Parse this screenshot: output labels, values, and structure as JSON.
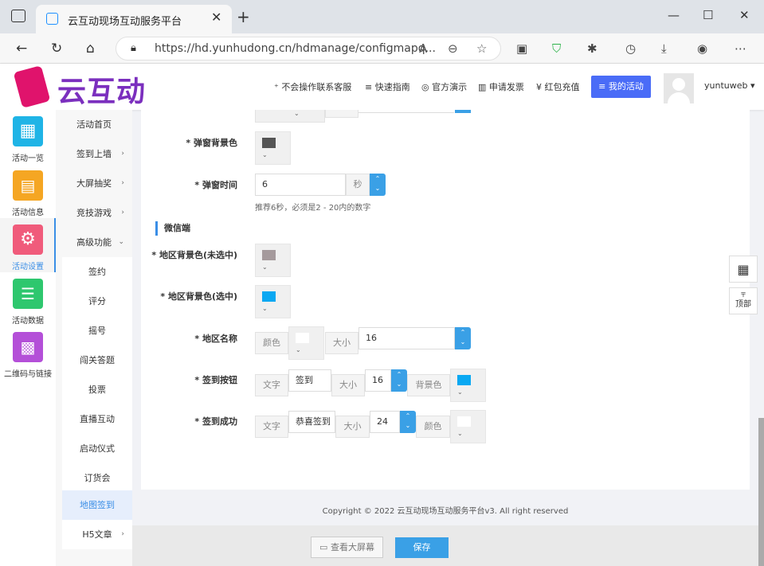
{
  "browser": {
    "tab_title": "云互动现场互动服务平台",
    "tab_close": "✕",
    "new_tab": "+",
    "url": "https://hd.yunhudong.cn/hdmanage/configmapq...",
    "win_min": "—",
    "win_max": "☐",
    "win_close": "✕"
  },
  "header": {
    "logo_text": "云互动",
    "links": [
      "不会操作联系客服",
      "快速指南",
      "官方演示",
      "申请发票",
      "红包充值"
    ],
    "my_activity": "我的活动",
    "username": "yuntuweb"
  },
  "sidebar": {
    "items": [
      {
        "label": "活动一览",
        "color": "#1fb4e6",
        "icon": "grid-icon"
      },
      {
        "label": "活动信息",
        "color": "#f5a623",
        "icon": "document-icon"
      },
      {
        "label": "活动设置",
        "color": "#f05b7b",
        "icon": "gear-icon"
      },
      {
        "label": "活动数据",
        "color": "#2ec76e",
        "icon": "database-icon"
      },
      {
        "label": "二维码与链接",
        "color": "#b44fd8",
        "icon": "qrcode-icon"
      }
    ]
  },
  "subnav": {
    "items": [
      {
        "label": "活动首页",
        "arrow": ""
      },
      {
        "label": "签到上墙",
        "arrow": "›"
      },
      {
        "label": "大屏抽奖",
        "arrow": "›"
      },
      {
        "label": "竞技游戏",
        "arrow": "›"
      },
      {
        "label": "高级功能",
        "arrow": "⌄"
      },
      {
        "label": "签约",
        "arrow": ""
      },
      {
        "label": "评分",
        "arrow": ""
      },
      {
        "label": "摇号",
        "arrow": ""
      },
      {
        "label": "闯关答题",
        "arrow": ""
      },
      {
        "label": "投票",
        "arrow": ""
      },
      {
        "label": "直播互动",
        "arrow": ""
      },
      {
        "label": "启动仪式",
        "arrow": ""
      },
      {
        "label": "订货会",
        "arrow": ""
      },
      {
        "label": "地图签到",
        "arrow": ""
      },
      {
        "label": "H5文章",
        "arrow": "›"
      }
    ]
  },
  "form": {
    "popup_bg_label": "* 弹窗背景色",
    "popup_bg_color": "#555555",
    "popup_time_label": "* 弹窗时间",
    "popup_time_value": "6",
    "popup_time_unit": "秒",
    "popup_time_hint": "推荐6秒，必须是2 - 20内的数字",
    "section_wechat": "微信端",
    "area_bg_unsel_label": "* 地区背景色(未选中)",
    "area_bg_unsel_color": "#a59a9c",
    "area_bg_sel_label": "* 地区背景色(选中)",
    "area_bg_sel_color": "#0aa8f2",
    "area_name_label": "* 地区名称",
    "color_word": "颜色",
    "size_word": "大小",
    "text_word": "文字",
    "bgcolor_word": "背景色",
    "area_name_color": "#ffffff",
    "area_name_size": "16",
    "signin_btn_label": "* 签到按钮",
    "signin_btn_text": "签到",
    "signin_btn_size": "16",
    "signin_btn_bg": "#0aa8f2",
    "signin_ok_label": "* 签到成功",
    "signin_ok_text": "恭喜签到",
    "signin_ok_size": "24",
    "signin_ok_color": "#ffffff"
  },
  "footer": {
    "copyright": "Copyright © 2022 云互动现场互动服务平台v3. All right reserved",
    "view_screen": "查看大屏幕",
    "save": "保存"
  },
  "float": {
    "top_label": "顶部",
    "top_arrow": "〒"
  }
}
